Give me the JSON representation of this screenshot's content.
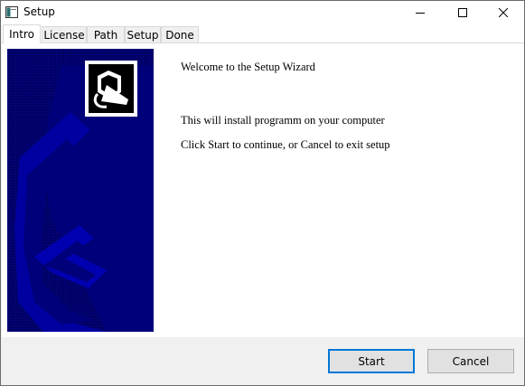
{
  "window": {
    "title": "Setup",
    "icon": "setup-app-icon",
    "controls": [
      "minimize-icon",
      "maximize-icon",
      "close-icon"
    ]
  },
  "tabs": [
    {
      "label": "Intro",
      "active": true
    },
    {
      "label": "License",
      "active": false
    },
    {
      "label": "Path",
      "active": false
    },
    {
      "label": "Setup",
      "active": false
    },
    {
      "label": "Done",
      "active": false
    }
  ],
  "content": {
    "welcome": "Welcome to the Setup Wizard",
    "install": "This will install programm on your computer",
    "continue": "Click Start to continue, or Cancel to exit setup"
  },
  "buttons": {
    "start": "Start",
    "cancel": "Cancel"
  },
  "colors": {
    "wizard_background": "#00007a",
    "focus_border": "#0078d7"
  }
}
